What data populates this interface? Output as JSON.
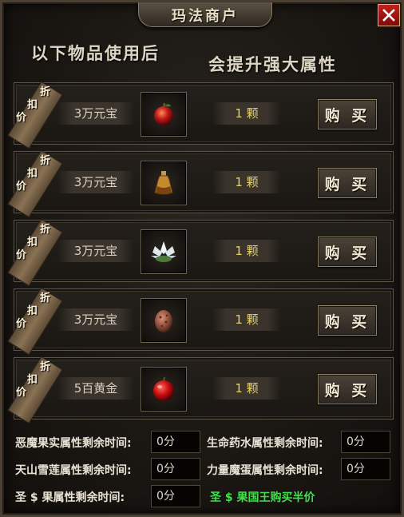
{
  "window": {
    "title": "玛法商户",
    "close_icon": "close-icon"
  },
  "headline": {
    "left": "以下物品使用后",
    "right": "会提升强大属性"
  },
  "ribbon": {
    "chars": [
      "折",
      "扣",
      "价"
    ]
  },
  "items": [
    {
      "price": "3万元宝",
      "qty": "1 颗",
      "buy": "购 买",
      "icon": "demon-fruit-icon"
    },
    {
      "price": "3万元宝",
      "qty": "1 颗",
      "buy": "购 买",
      "icon": "life-potion-icon"
    },
    {
      "price": "3万元宝",
      "qty": "1 颗",
      "buy": "购 买",
      "icon": "snow-lotus-icon"
    },
    {
      "price": "3万元宝",
      "qty": "1 颗",
      "buy": "购 买",
      "icon": "power-egg-icon"
    },
    {
      "price": "5百黄金",
      "qty": "1 颗",
      "buy": "购 买",
      "icon": "holy-fruit-icon"
    }
  ],
  "timers": [
    {
      "label": "恶魔果实属性剩余时间:",
      "value": "0分"
    },
    {
      "label": "生命药水属性剩余时间:",
      "value": "0分"
    },
    {
      "label": "天山雪莲属性剩余时间:",
      "value": "0分"
    },
    {
      "label": "力量魔蛋属性剩余时间:",
      "value": "0分"
    },
    {
      "label": "圣 $ 果属性剩余时间:",
      "value": "0分"
    }
  ],
  "promo": "圣 $ 果国王购买半价",
  "colors": {
    "promo": "#3fe04a",
    "qty": "#e3cf6e",
    "close": "#c3201b"
  }
}
